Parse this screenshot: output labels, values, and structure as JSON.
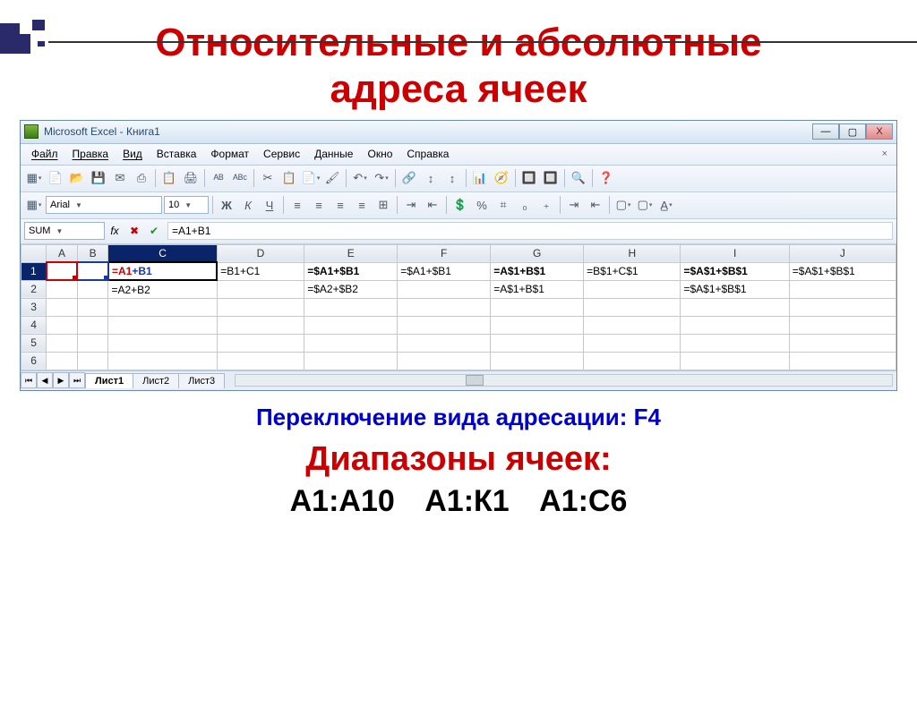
{
  "slide": {
    "title_line1": "Относительные и абсолютные",
    "title_line2": "адреса ячеек",
    "caption_switch": "Переключение вида адресации:  F4",
    "caption_ranges_title": "Диапазоны ячеек:",
    "caption_ranges_line": "А1:А10     А1:К1     А1:С6"
  },
  "window": {
    "title": "Microsoft Excel - Книга1",
    "controls": {
      "min": "—",
      "max": "▢",
      "close": "X"
    },
    "doc_close": "×"
  },
  "menu": {
    "items": [
      "Файл",
      "Правка",
      "Вид",
      "Вставка",
      "Формат",
      "Сервис",
      "Данные",
      "Окно",
      "Справка"
    ]
  },
  "toolbar1_icons": [
    "▦",
    "📄",
    "📂",
    "💾",
    "✉",
    "⎙",
    "",
    "📋",
    "🖨",
    "",
    "ᴬᴮ",
    "ᴬᴮᶜ",
    "",
    "✂",
    "📋",
    "📄",
    "🖌",
    "",
    "↶",
    "↷",
    "",
    "🔗",
    "↕",
    "↕",
    "",
    "📊",
    "🧭",
    "",
    "🔲",
    "🔲",
    "",
    "🔍",
    "",
    "❓"
  ],
  "format": {
    "font": "Arial",
    "size": "10",
    "buttons": [
      "Ж",
      "К",
      "Ч",
      "",
      "≡",
      "≡",
      "≡",
      "≡",
      "⊞",
      "",
      "⇥",
      "⇤",
      "",
      "💲",
      "%",
      "⌗",
      "₀",
      "₊",
      "",
      "⇥",
      "⇤",
      "",
      "▢",
      "▢",
      "A̲"
    ]
  },
  "formula_bar": {
    "name_box": "SUM",
    "fx": "fx",
    "cancel": "✖",
    "accept": "✔",
    "value": "=A1+B1"
  },
  "sheet": {
    "columns": [
      "A",
      "B",
      "C",
      "D",
      "E",
      "F",
      "G",
      "H",
      "I",
      "J"
    ],
    "rows": [
      "1",
      "2",
      "3",
      "4",
      "5",
      "6"
    ],
    "data": {
      "C1_a": "=A1",
      "C1_b": "+B1",
      "D1": "=B1+C1",
      "E1": "=$A1+$B1",
      "F1": "=$A1+$B1",
      "G1": "=A$1+B$1",
      "H1": "=B$1+C$1",
      "I1": "=$A$1+$B$1",
      "J1": "=$A$1+$B$1",
      "C2": "=A2+B2",
      "E2": "=$A2+$B2",
      "G2": "=A$1+B$1",
      "I2": "=$A$1+$B$1"
    }
  },
  "tabs": {
    "nav": [
      "⏮",
      "◀",
      "▶",
      "⏭"
    ],
    "items": [
      "Лист1",
      "Лист2",
      "Лист3"
    ]
  }
}
